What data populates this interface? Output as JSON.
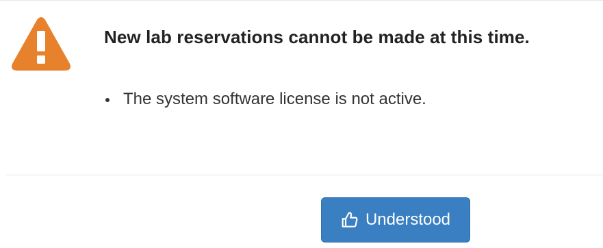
{
  "dialog": {
    "icon": "warning-triangle-icon",
    "title": "New lab reservations cannot be made at this time.",
    "messages": [
      "The system software license is not active."
    ],
    "button": {
      "label": "Understood",
      "icon": "thumbs-up-outline-icon"
    },
    "colors": {
      "warning": "#e8812c",
      "button": "#3a7fc1",
      "title_text": "#222222"
    }
  }
}
